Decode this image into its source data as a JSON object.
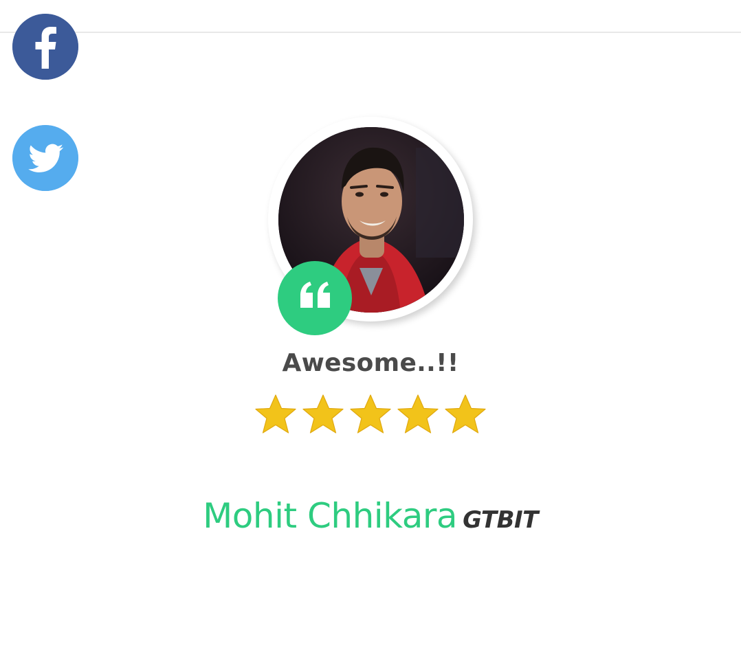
{
  "social": {
    "facebook_icon": "facebook-icon",
    "twitter_icon": "twitter-icon",
    "facebook_color": "#3c5a99",
    "twitter_color": "#55acee"
  },
  "testimonial": {
    "quote_icon": "quote-icon",
    "accent_color": "#2ecc80",
    "headline": "Awesome..!!",
    "rating": 5,
    "rating_max": 5,
    "star_color": "#f2c31a",
    "author_name": "Mohit Chhikara",
    "author_org": "GTBIT"
  }
}
